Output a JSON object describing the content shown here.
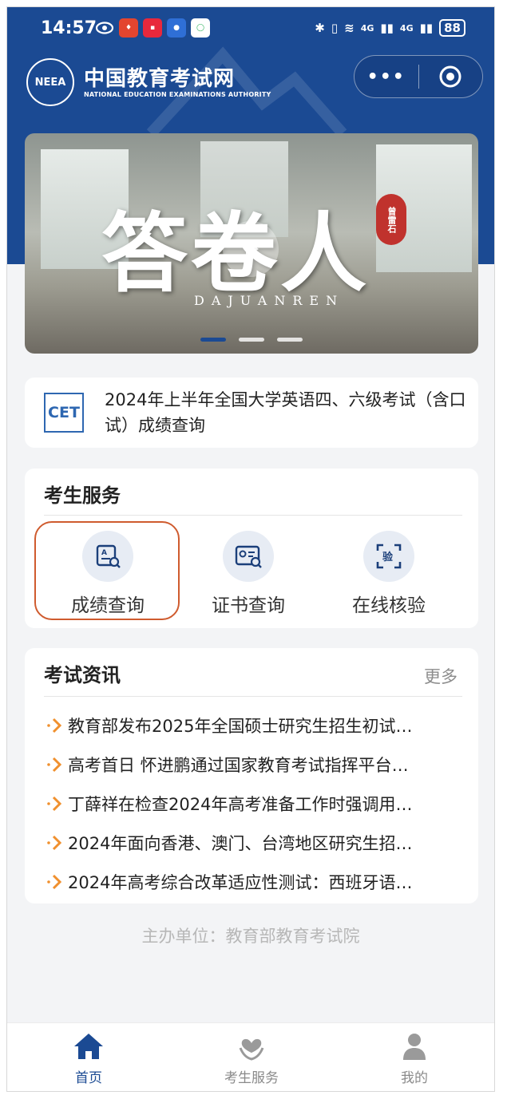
{
  "status_bar": {
    "time": "14:57",
    "battery": "88",
    "network_1": "4G",
    "network_2": "4G"
  },
  "header": {
    "logo_abbr": "NEEA",
    "org_name_cn": "中国教育考试网",
    "org_name_en": "NATIONAL EDUCATION EXAMINATIONS AUTHORITY",
    "capsule_more": "•••"
  },
  "banner": {
    "title": "答卷人",
    "subtitle": "DAJUANREN",
    "seal_text": "曾雷石"
  },
  "announcement": {
    "badge": "CET",
    "text": "2024年上半年全国大学英语四、六级考试（含口试）成绩查询"
  },
  "services": {
    "title": "考生服务",
    "items": [
      {
        "label": "成绩查询",
        "icon": "score-search-icon"
      },
      {
        "label": "证书查询",
        "icon": "certificate-search-icon"
      },
      {
        "label": "在线核验",
        "icon": "online-verify-icon"
      }
    ]
  },
  "news": {
    "title": "考试资讯",
    "more": "更多",
    "items": [
      "教育部发布2025年全国硕士研究生招生初试…",
      "高考首日 怀进鹏通过国家教育考试指挥平台…",
      "丁薛祥在检查2024年高考准备工作时强调用…",
      "2024年面向香港、澳门、台湾地区研究生招…",
      "2024年高考综合改革适应性测试：西班牙语…"
    ]
  },
  "footer": {
    "organizer": "主办单位：教育部教育考试院"
  },
  "tabbar": {
    "items": [
      {
        "label": "首页",
        "icon": "home-icon",
        "active": true
      },
      {
        "label": "考生服务",
        "icon": "candidate-service-icon",
        "active": false
      },
      {
        "label": "我的",
        "icon": "profile-icon",
        "active": false
      }
    ]
  },
  "colors": {
    "brand": "#1b4a93",
    "highlight": "#cf5b2e",
    "arrow": "#f0902e"
  }
}
